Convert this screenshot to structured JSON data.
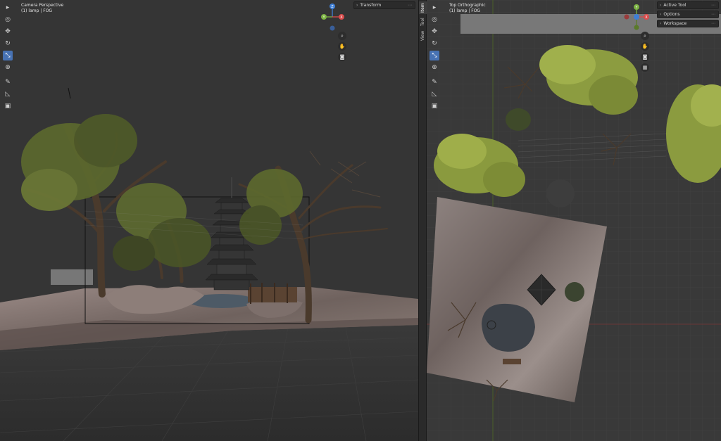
{
  "left_viewport": {
    "title": "Camera Perspective",
    "subtitle": "(1) lamp | FOG",
    "transform_panel": "Transform"
  },
  "right_viewport": {
    "title": "Top Orthographic",
    "subtitle": "(1) lamp | FOG",
    "panels": [
      "Active Tool",
      "Options",
      "Workspace"
    ]
  },
  "sidebar_tabs": [
    "Item",
    "Tool",
    "View"
  ],
  "toolbar": [
    {
      "icon": "select-box-icon",
      "glyph": "⬚"
    },
    {
      "icon": "cursor-icon",
      "glyph": "◎"
    },
    {
      "icon": "move-icon",
      "glyph": "✥"
    },
    {
      "icon": "rotate-icon",
      "glyph": "↻"
    },
    {
      "icon": "scale-icon",
      "glyph": "⤡"
    },
    {
      "icon": "transform-icon",
      "glyph": "⊕"
    },
    {
      "icon": "annotate-icon",
      "glyph": "✎"
    },
    {
      "icon": "measure-icon",
      "glyph": "📐"
    },
    {
      "icon": "add-cube-icon",
      "glyph": "▣"
    }
  ],
  "gizmo": {
    "axis_labels": {
      "x": "X",
      "y": "Y",
      "z": "Z"
    },
    "colors": {
      "x": "#d94b4b",
      "y": "#7cb342",
      "z": "#3f7fd6"
    }
  },
  "nav_icons": [
    "zoom-icon",
    "pan-hand-icon",
    "camera-view-icon",
    "grid-view-icon"
  ],
  "colors": {
    "active_tool": "#4772b3",
    "viewport_bg": "#353535",
    "x_axis_line": "#8a3a3a",
    "y_axis_line": "#5a7a2a"
  }
}
